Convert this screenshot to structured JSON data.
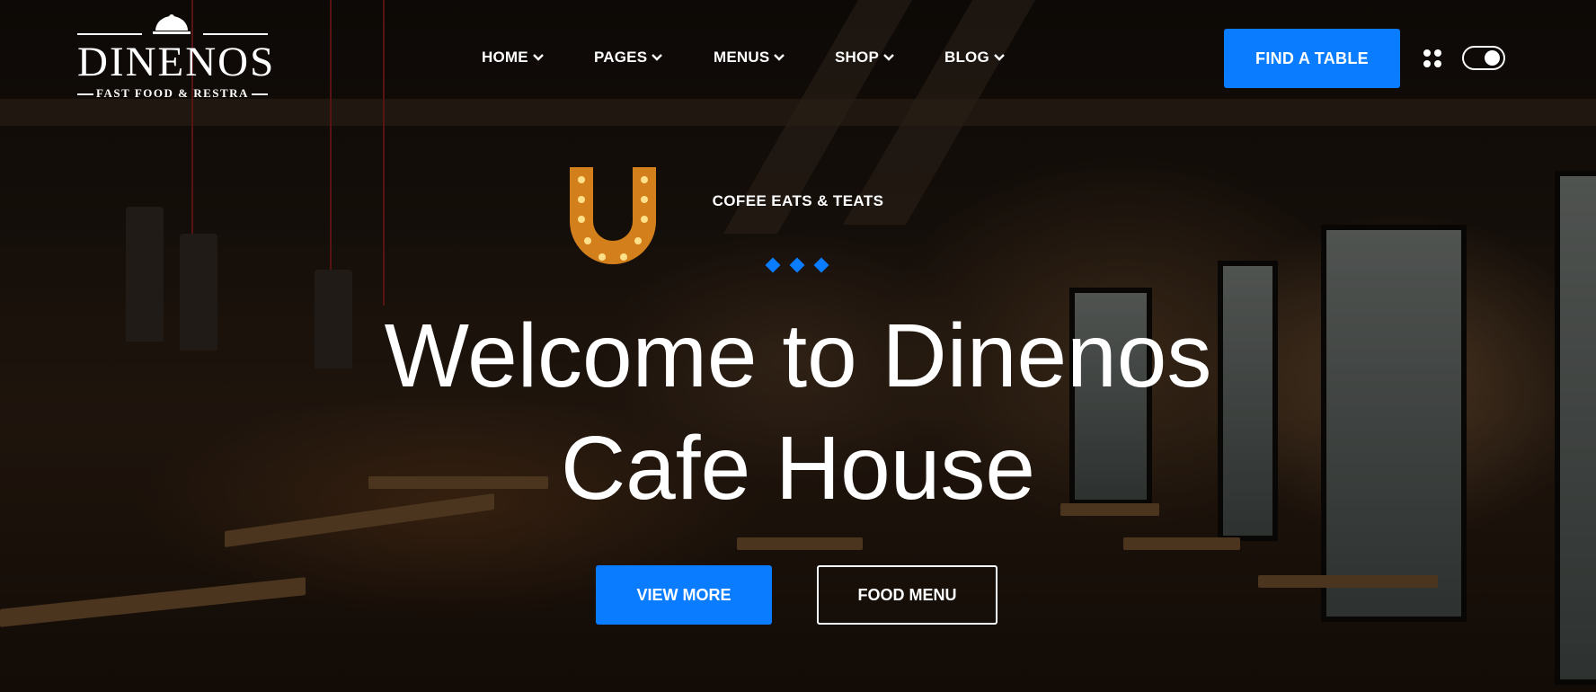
{
  "logo": {
    "brand": "DINENOS",
    "tagline": "FAST FOOD & RESTRA",
    "icon": "cloche-icon"
  },
  "nav": {
    "items": [
      {
        "label": "HOME",
        "icon": "chevron-down-icon"
      },
      {
        "label": "PAGES",
        "icon": "chevron-down-icon"
      },
      {
        "label": "MENUS",
        "icon": "chevron-down-icon"
      },
      {
        "label": "SHOP",
        "icon": "chevron-down-icon"
      },
      {
        "label": "BLOG",
        "icon": "chevron-down-icon"
      }
    ]
  },
  "header": {
    "cta_label": "FIND A TABLE",
    "menu_icon": "grid-dots-icon",
    "theme_toggle": "toggle-switch-icon"
  },
  "hero": {
    "eyebrow": "COFEE EATS & TEATS",
    "title_line1": "Welcome to Dinenos",
    "title_line2": "Cafe House",
    "primary_label": "VIEW MORE",
    "secondary_label": "FOOD MENU"
  },
  "colors": {
    "accent": "#0a7cff",
    "text": "#ffffff"
  }
}
